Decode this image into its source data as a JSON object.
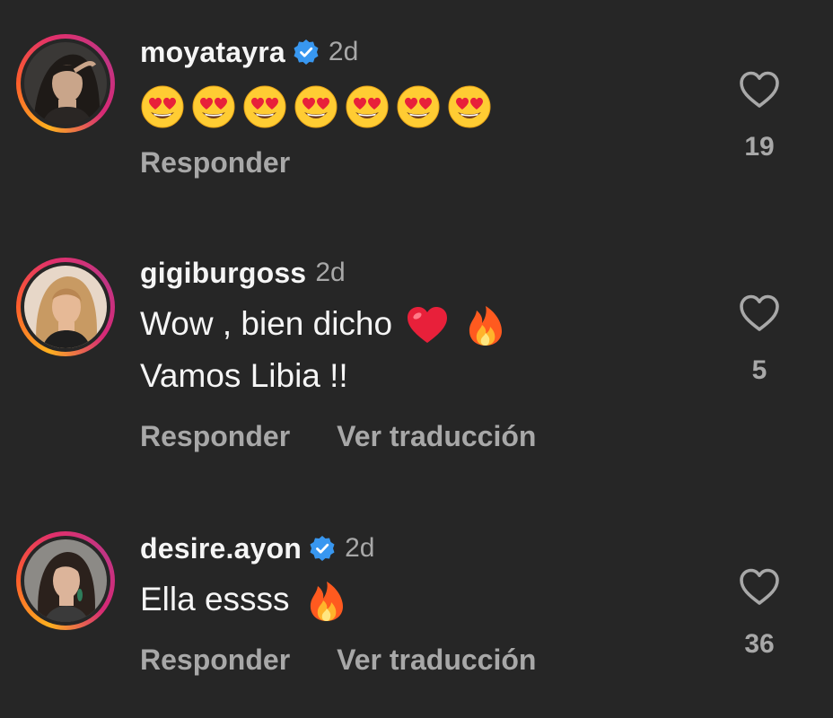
{
  "comments": [
    {
      "username": "moyatayra",
      "verified": true,
      "time": "2d",
      "text_lines": [],
      "emojis": [
        "heart-eyes",
        "heart-eyes",
        "heart-eyes",
        "heart-eyes",
        "heart-eyes",
        "heart-eyes",
        "heart-eyes"
      ],
      "actions": [
        "Responder"
      ],
      "likes": "19"
    },
    {
      "username": "gigiburgoss",
      "verified": false,
      "time": "2d",
      "text_lines": [
        "Wow , bien dicho",
        "Vamos Libia !!"
      ],
      "actions": [
        "Responder",
        "Ver traducción"
      ],
      "likes": "5"
    },
    {
      "username": "desire.ayon",
      "verified": true,
      "time": "2d",
      "text_lines": [
        "Ella essss"
      ],
      "actions": [
        "Responder",
        "Ver traducción"
      ],
      "likes": "36"
    }
  ],
  "colors": {
    "background": "#262626",
    "primary_text": "#f5f5f5",
    "secondary_text": "#a8a8a8",
    "verified_badge": "#3897f0"
  },
  "icons": {
    "verified": "verified-badge-icon",
    "like": "heart-outline-icon",
    "emoji_heart_eyes": "heart-eyes-emoji",
    "emoji_red_heart": "red-heart-emoji",
    "emoji_fire": "fire-emoji"
  }
}
